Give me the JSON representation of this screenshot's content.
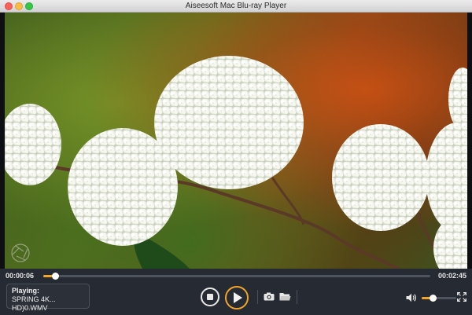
{
  "window": {
    "title": "Aiseesoft Mac Blu-ray Player"
  },
  "playback": {
    "elapsed": "00:00:06",
    "total": "00:02:45",
    "progress_fraction": 0.03,
    "volume_fraction": 0.32
  },
  "now_playing": {
    "label": "Playing:",
    "filename": "SPRING 4K... HD)0.WMV"
  },
  "icons": {
    "logo": "aperture-logo-icon",
    "stop": "stop-icon",
    "play": "play-icon",
    "snapshot": "camera-icon",
    "open": "folder-icon",
    "volume": "speaker-icon",
    "fullscreen": "fullscreen-icon"
  },
  "colors": {
    "accent": "#f2a52a",
    "control_bg": "#262b33"
  }
}
